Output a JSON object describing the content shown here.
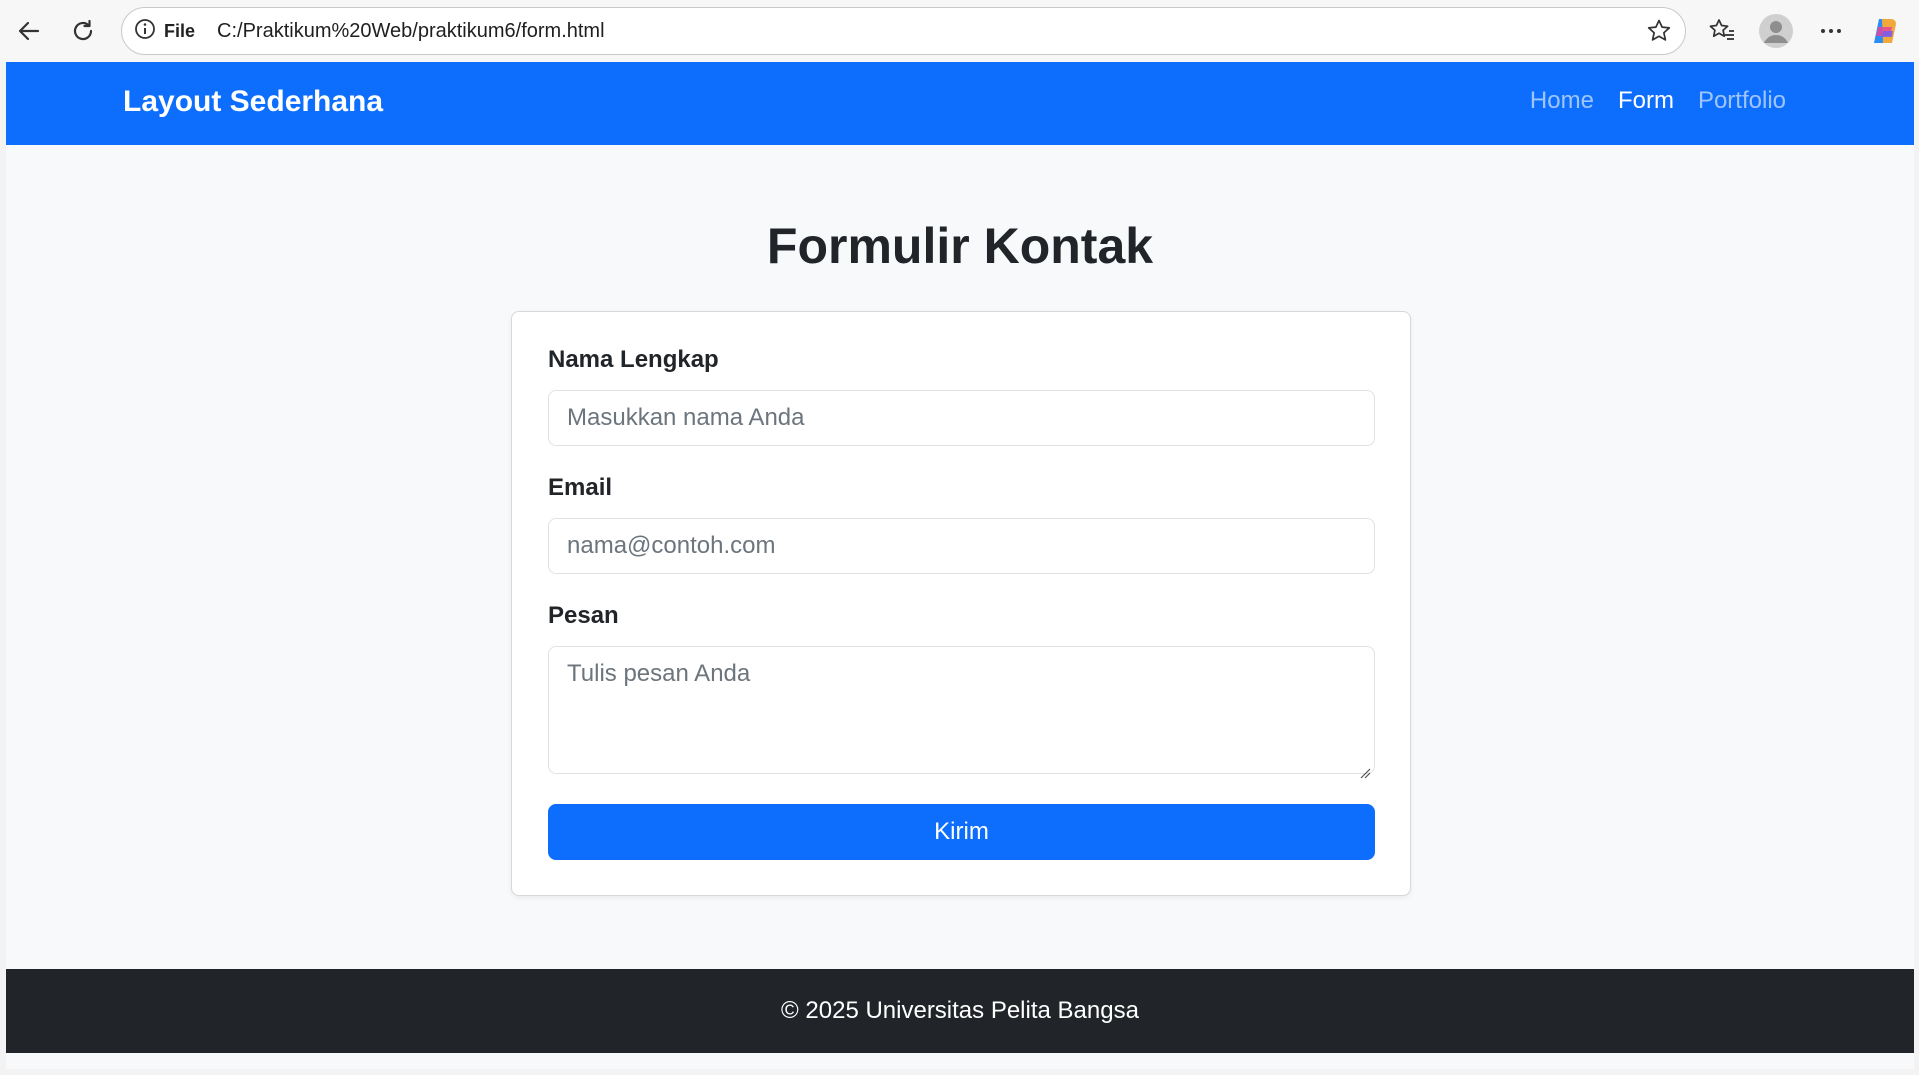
{
  "browser": {
    "file_label": "File",
    "url": "C:/Praktikum%20Web/praktikum6/form.html",
    "icons": [
      "back-arrow-icon",
      "reload-icon",
      "info-icon",
      "star-icon",
      "favorites-icon",
      "profile-icon",
      "more-icon",
      "copilot-icon"
    ]
  },
  "navbar": {
    "brand": "Layout Sederhana",
    "links": [
      {
        "label": "Home",
        "active": false
      },
      {
        "label": "Form",
        "active": true
      },
      {
        "label": "Portfolio",
        "active": false
      }
    ],
    "color": "#0d6efd"
  },
  "main": {
    "title": "Formulir Kontak",
    "form": {
      "name": {
        "label": "Nama Lengkap",
        "placeholder": "Masukkan nama Anda"
      },
      "email": {
        "label": "Email",
        "placeholder": "nama@contoh.com"
      },
      "message": {
        "label": "Pesan",
        "placeholder": "Tulis pesan Anda"
      },
      "submit_label": "Kirim"
    }
  },
  "footer": {
    "text": "© 2025 Universitas Pelita Bangsa",
    "color": "#212529"
  }
}
